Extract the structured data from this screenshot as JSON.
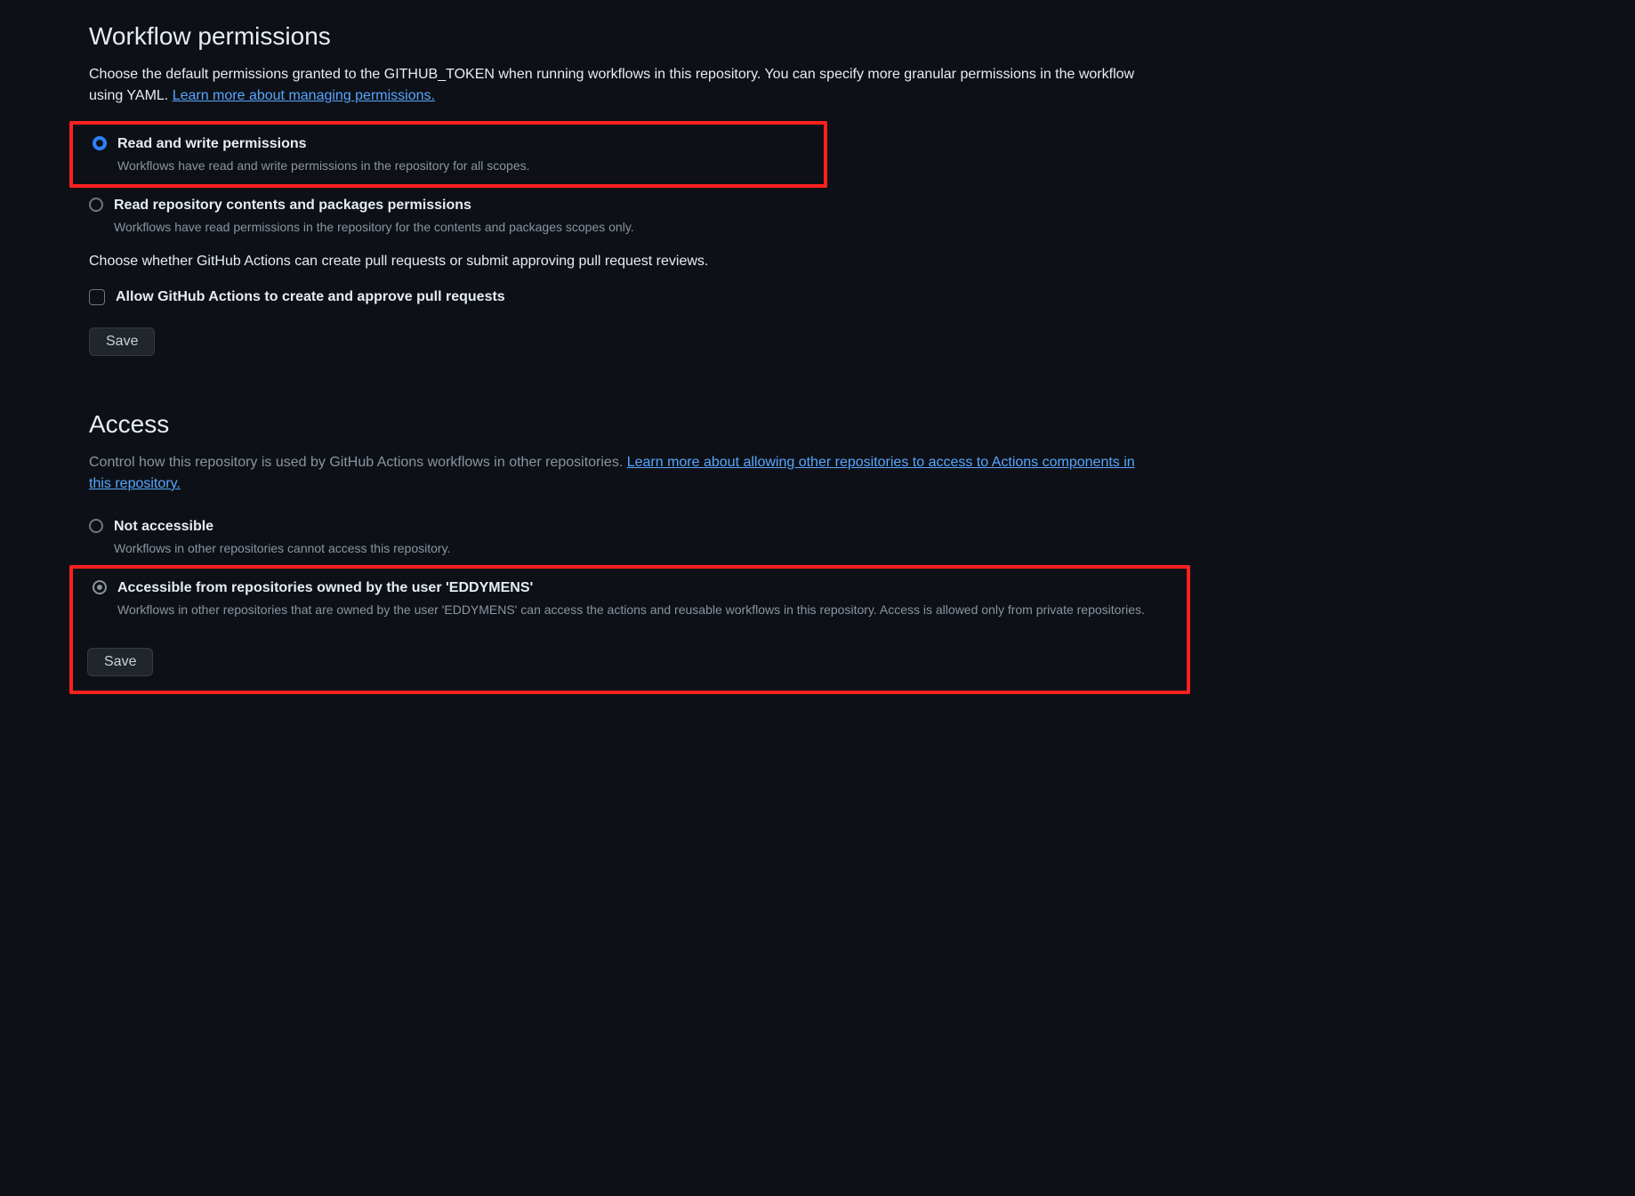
{
  "workflow_permissions": {
    "title": "Workflow permissions",
    "description_part1": "Choose the default permissions granted to the GITHUB_TOKEN when running workflows in this repository. You can specify more granular permissions in the workflow using YAML. ",
    "link_text": "Learn more about managing permissions.",
    "options": {
      "read_write": {
        "label": "Read and write permissions",
        "description": "Workflows have read and write permissions in the repository for all scopes."
      },
      "read_only": {
        "label": "Read repository contents and packages permissions",
        "description": "Workflows have read permissions in the repository for the contents and packages scopes only."
      }
    },
    "pr_description": "Choose whether GitHub Actions can create pull requests or submit approving pull request reviews.",
    "allow_pr_checkbox": "Allow GitHub Actions to create and approve pull requests",
    "save_button": "Save"
  },
  "access": {
    "title": "Access",
    "description_part1": "Control how this repository is used by GitHub Actions workflows in other repositories. ",
    "link_text": "Learn more about allowing other repositories to access to Actions components in this repository.",
    "options": {
      "not_accessible": {
        "label": "Not accessible",
        "description": "Workflows in other repositories cannot access this repository."
      },
      "accessible_from_user": {
        "label": "Accessible from repositories owned by the user 'EDDYMENS'",
        "description": "Workflows in other repositories that are owned by the user 'EDDYMENS' can access the actions and reusable workflows in this repository. Access is allowed only from private repositories."
      }
    },
    "save_button": "Save"
  }
}
